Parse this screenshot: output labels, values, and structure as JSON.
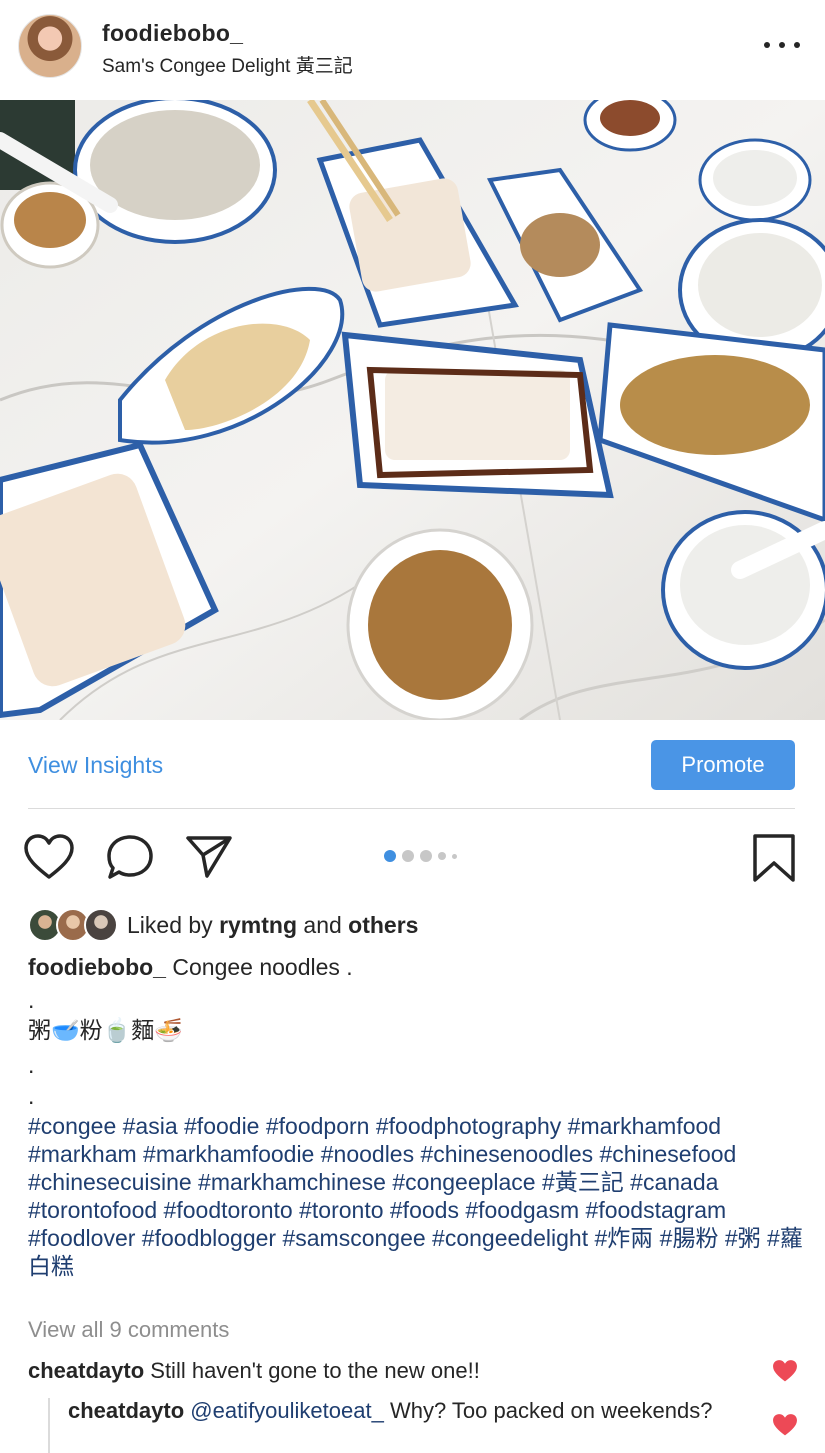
{
  "post": {
    "username": "foodiebobo_",
    "location": "Sam's Congee Delight 黃三記"
  },
  "actions": {
    "view_insights": "View Insights",
    "promote": "Promote"
  },
  "carousel": {
    "total": 5,
    "active": 1
  },
  "likes": {
    "prefix": "Liked by ",
    "user": "rymtng",
    "middle": " and ",
    "others": "others"
  },
  "caption": {
    "username": "foodiebobo_",
    "text": " Congee noodles .",
    "line2": ".",
    "line3": "粥🥣粉🍵麵🍜",
    "line4": ".",
    "line5": ".",
    "hashtags": "#congee #asia #foodie #foodporn #foodphotography #markhamfood #markham #markhamfoodie #noodles #chinesenoodles #chinesefood #chinesecuisine #markhamchinese #congeeplace #黃三記 #canada #torontofood #foodtoronto #toronto #foods #foodgasm #foodstagram #foodlover #foodblogger #samscongee #congeedelight #炸兩 #腸粉 #粥 #蘿白糕"
  },
  "comments": {
    "view_all": "View all 9 comments",
    "items": [
      {
        "user": "cheatdayto",
        "text": " Still haven't gone to the new one!!"
      },
      {
        "user": "cheatdayto",
        "mention": " @eatifyouliketoeat_",
        "text": " Why? Too packed on weekends?"
      }
    ]
  },
  "colors": {
    "accent": "#3f8fe0",
    "promote_bg": "#4a95e6",
    "hashtag": "#1f3e70",
    "like_red": "#ed4956",
    "muted": "#8e8e8e"
  }
}
